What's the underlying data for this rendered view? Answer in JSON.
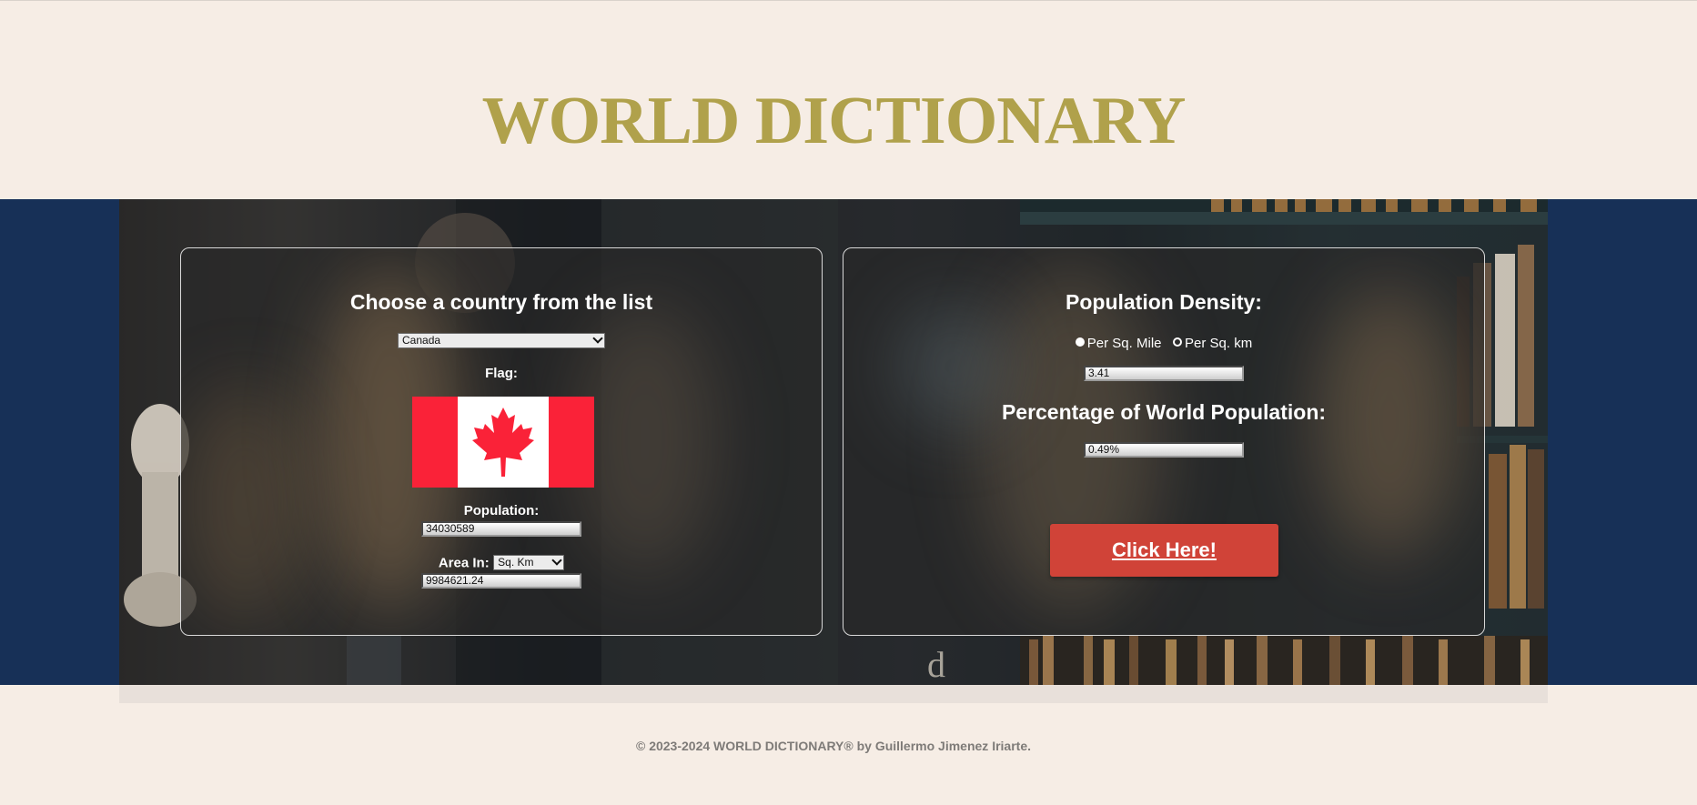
{
  "header": {
    "title": "WORLD DICTIONARY"
  },
  "country_panel": {
    "heading": "Choose a country from the list",
    "country_select": {
      "selected": "Canada"
    },
    "flag_label": "Flag:",
    "flag_icon": "canada-flag-maple-leaf",
    "population_label": "Population:",
    "population_value": "34030589",
    "area_label": "Area In:",
    "area_unit_select": {
      "selected": "Sq. Km"
    },
    "area_value": "9984621.24"
  },
  "stats_panel": {
    "density_heading": "Population Density:",
    "radio_options": [
      {
        "label": "Per Sq. Mile",
        "selected": true
      },
      {
        "label": "Per Sq. km",
        "selected": false
      }
    ],
    "density_value": "3.41",
    "percentage_heading": "Percentage of World Population:",
    "percentage_value": "0.49%",
    "button_label": "Click Here!"
  },
  "footer": {
    "text": "© 2023-2024 WORLD DICTIONARY® by Guillermo Jimenez Iriarte."
  },
  "colors": {
    "title": "#b0a14b",
    "band": "#173057",
    "page_background": "#f6ede5",
    "button": "#d04338",
    "flag_red": "#fa2238"
  }
}
